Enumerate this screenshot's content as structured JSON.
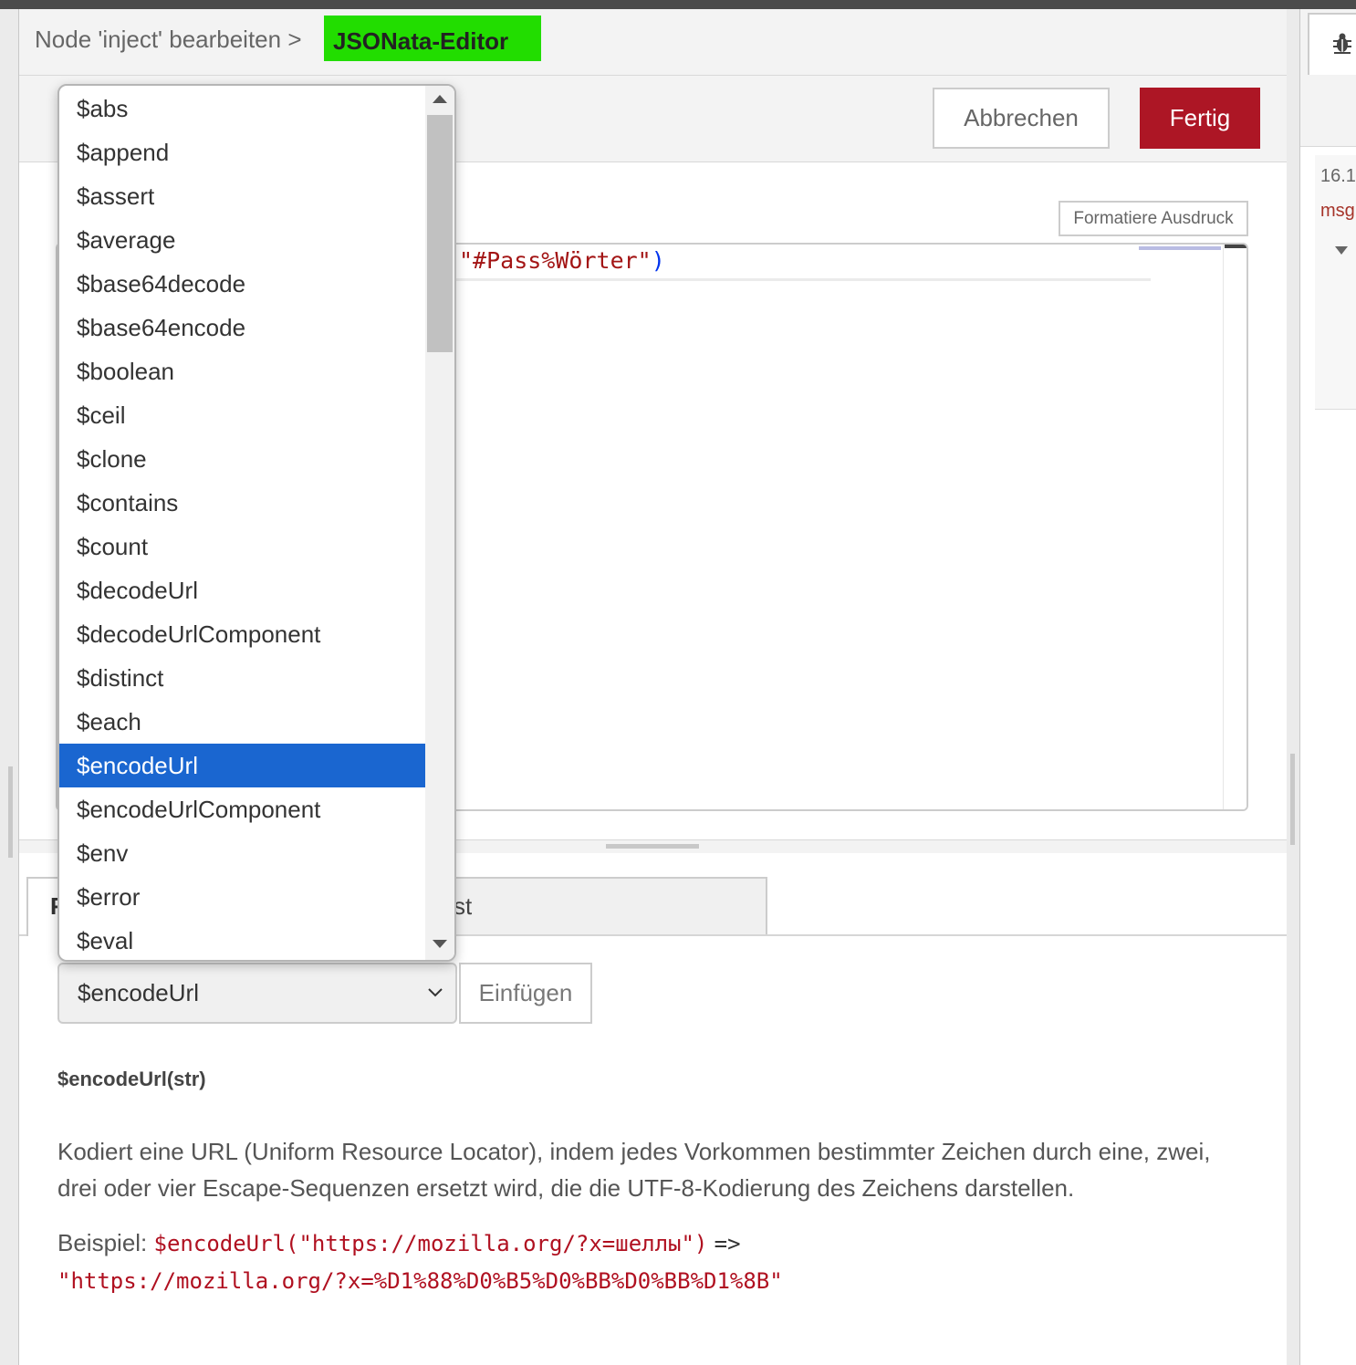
{
  "breadcrumb": {
    "parent": "Node 'inject' bearbeiten",
    "separator": ">",
    "current": "JSONata-Editor"
  },
  "actions": {
    "cancel": "Abbrechen",
    "done": "Fertig",
    "format": "Formatiere Ausdruck"
  },
  "editor": {
    "visible_code_string": "\"#Pass%Wörter\"",
    "visible_code_close": ")"
  },
  "tabs": [
    {
      "label": "F"
    },
    {
      "label": "st"
    }
  ],
  "function_list": {
    "items": [
      "$abs",
      "$append",
      "$assert",
      "$average",
      "$base64decode",
      "$base64encode",
      "$boolean",
      "$ceil",
      "$clone",
      "$contains",
      "$count",
      "$decodeUrl",
      "$decodeUrlComponent",
      "$distinct",
      "$each",
      "$encodeUrl",
      "$encodeUrlComponent",
      "$env",
      "$error",
      "$eval"
    ],
    "selected_index": 15
  },
  "function_select": {
    "value": "$encodeUrl",
    "insert_label": "Einfügen"
  },
  "help": {
    "signature": "$encodeUrl(str)",
    "description": "Kodiert eine URL (Uniform Resource Locator), indem jedes Vorkommen bestimmter Zeichen durch eine, zwei, drei oder vier Escape-Sequenzen ersetzt wird, die die UTF-8-Kodierung des Zeichens darstellen.",
    "example_label": "Beispiel:",
    "example_code": "$encodeUrl(\"https://mozilla.org/?x=шеллы\")",
    "example_arrow": "=>",
    "example_result": "\"https://mozilla.org/?x=%D1%88%D0%B5%D0%BB%D0%BB%D1%8B\""
  },
  "sidebar": {
    "tab_icon": "bug-icon",
    "time": "16.1",
    "msg": "msg"
  },
  "colors": {
    "accent": "#22dd00",
    "primary_button": "#ad1625",
    "selection": "#1a66d0",
    "code_string": "#a31515"
  }
}
